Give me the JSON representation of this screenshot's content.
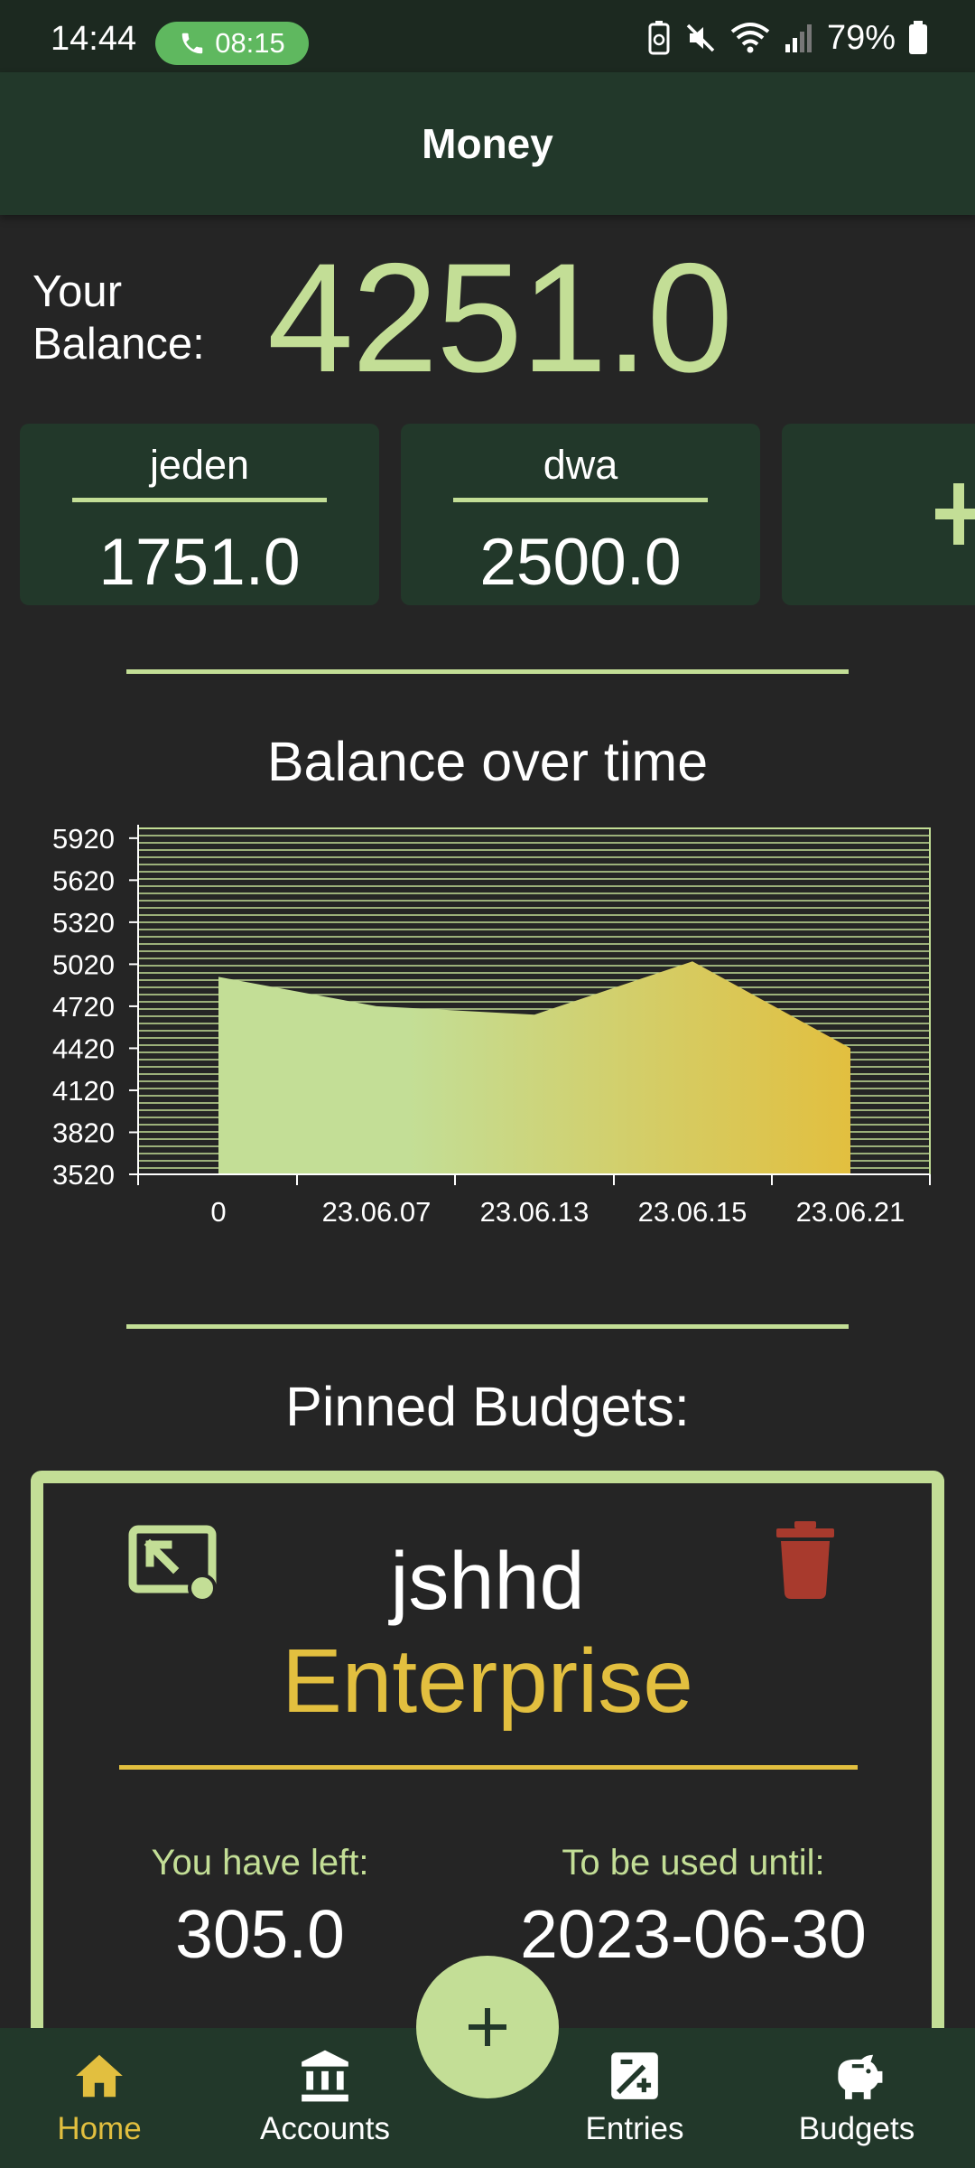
{
  "status_bar": {
    "time": "14:44",
    "call_timer": "08:15",
    "battery_percent": "79%"
  },
  "app_bar": {
    "title": "Money"
  },
  "balance": {
    "label_line1": "Your",
    "label_line2": "Balance:",
    "value": "4251.0"
  },
  "accounts": [
    {
      "name": "jeden",
      "amount": "1751.0"
    },
    {
      "name": "dwa",
      "amount": "2500.0"
    }
  ],
  "chart_section": {
    "title": "Balance over time"
  },
  "chart_data": {
    "type": "area",
    "x": [
      "0",
      "23.06.07",
      "23.06.13",
      "23.06.15",
      "23.06.21"
    ],
    "y_ticks": [
      5920,
      5620,
      5320,
      5020,
      4720,
      4420,
      4120,
      3820,
      3520
    ],
    "ylim": [
      3520,
      5990
    ],
    "points": [
      {
        "x": "0",
        "y": 4930
      },
      {
        "x": "23.06.07",
        "y": 4720
      },
      {
        "x": "23.06.13",
        "y": 4660
      },
      {
        "x": "23.06.15",
        "y": 5040
      },
      {
        "x": "23.06.21",
        "y": 4420
      }
    ],
    "grid": true,
    "fill_gradient": [
      "#c3de96",
      "#e2bf3f"
    ]
  },
  "budgets_section": {
    "title": "Pinned Budgets:"
  },
  "pinned_budget": {
    "name": "jshhd",
    "type": "Enterprise",
    "left_label": "You have left:",
    "left_value": "305.0",
    "until_label": "To be used until:",
    "until_value": "2023-06-30"
  },
  "bottom_nav": {
    "items": [
      {
        "label": "Home",
        "icon": "home-icon",
        "active": true
      },
      {
        "label": "Accounts",
        "icon": "bank-icon",
        "active": false
      },
      {
        "label": "Entries",
        "icon": "edit-entry-icon",
        "active": false
      },
      {
        "label": "Budgets",
        "icon": "piggy-bank-icon",
        "active": false
      }
    ]
  },
  "colors": {
    "accent_green": "#c3de96",
    "accent_yellow": "#e2bf3f",
    "dark_green": "#22382a",
    "background": "#252525",
    "delete_red": "#a83a2d"
  }
}
